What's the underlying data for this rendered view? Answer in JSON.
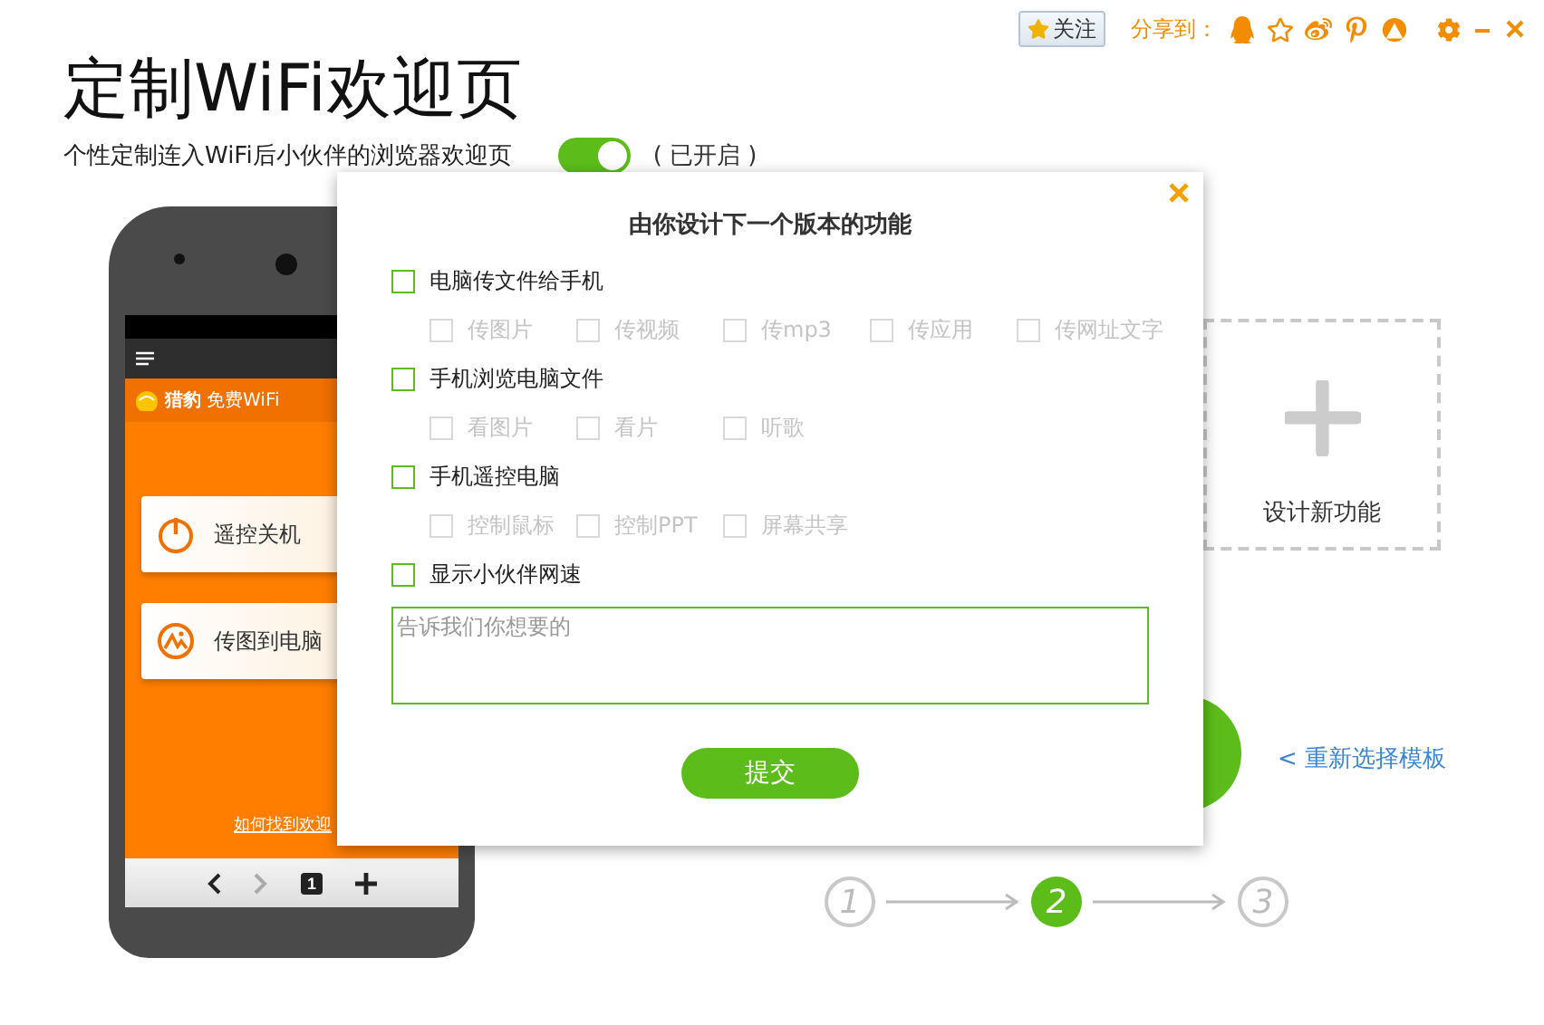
{
  "toolbar": {
    "follow_button": "关注",
    "share_label": "分享到："
  },
  "header": {
    "title": "定制WiFi欢迎页",
    "subtitle": "个性定制连入WiFi后小伙伴的浏览器欢迎页",
    "toggle": {
      "on": true
    },
    "toggle_status": "( 已开启 )"
  },
  "phone": {
    "brand": "猎豹",
    "brand_suffix": "免费WiFi",
    "buttons": [
      {
        "label": "遥控关机",
        "kind": "power"
      },
      {
        "label": "传图到电脑",
        "kind": "photo"
      }
    ],
    "help_link": "如何找到欢迎",
    "tab_count": "1"
  },
  "new_feature_card": {
    "label": "设计新功能"
  },
  "reselect_link": "< 重新选择模板",
  "steps": [
    {
      "label": "1",
      "selected": false
    },
    {
      "label": "2",
      "selected": true
    },
    {
      "label": "3",
      "selected": false
    }
  ],
  "dialog": {
    "title": "由你设计下一个版本的功能",
    "features": [
      {
        "label": "电脑传文件给手机",
        "checked": false,
        "options": [
          {
            "label": "传图片",
            "checked": false,
            "disabled": true
          },
          {
            "label": "传视频",
            "checked": false,
            "disabled": true
          },
          {
            "label": "传mp3",
            "checked": false,
            "disabled": true
          },
          {
            "label": "传应用",
            "checked": false,
            "disabled": true
          },
          {
            "label": "传网址文字",
            "checked": false,
            "disabled": true
          }
        ]
      },
      {
        "label": "手机浏览电脑文件",
        "checked": false,
        "options": [
          {
            "label": "看图片",
            "checked": false,
            "disabled": true
          },
          {
            "label": "看片",
            "checked": false,
            "disabled": true
          },
          {
            "label": "听歌",
            "checked": false,
            "disabled": true
          }
        ]
      },
      {
        "label": "手机遥控电脑",
        "checked": false,
        "options": [
          {
            "label": "控制鼠标",
            "checked": false,
            "disabled": true
          },
          {
            "label": "控制PPT",
            "checked": false,
            "disabled": true
          },
          {
            "label": "屏幕共享",
            "checked": false,
            "disabled": true
          }
        ]
      },
      {
        "label": "显示小伙伴网速",
        "checked": false
      }
    ],
    "feedback": {
      "placeholder": "告诉我们你想要的"
    },
    "submit": "提交"
  }
}
